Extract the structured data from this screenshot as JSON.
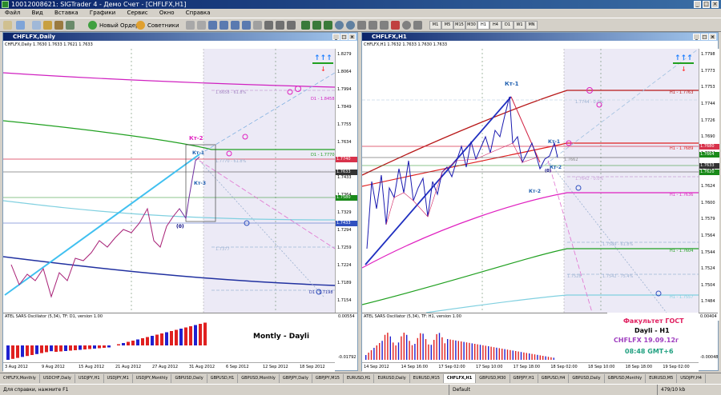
{
  "app": {
    "title": "10012008621: SIGTrader 4 - Демо Счет - [CHFLFX,H1]",
    "controls": [
      "_",
      "□",
      "×"
    ]
  },
  "menu": [
    "Файл",
    "Вид",
    "Вставка",
    "Графики",
    "Сервис",
    "Окно",
    "Справка"
  ],
  "toolbar": {
    "new_order": "Новый Ордер",
    "advisors": "Советники",
    "timeframes": [
      "M1",
      "M5",
      "M15",
      "M30",
      "H1",
      "H4",
      "D1",
      "W1",
      "MN"
    ]
  },
  "left_window": {
    "title": "CHFLFX,Daily",
    "price_line": "CHFLFX,Daily  1.7630 1.7633 1.7621 1.7633",
    "labels": {
      "kt2": "Кт-2",
      "kt1": "Кт-1",
      "kt3": "Кт-3",
      "zero": "(0)",
      "top_pct": "1.6658 - 61.8%",
      "d1_top": "D1 - 1.8458",
      "d1_mid": "D1 - 1.7770",
      "mid_pct": "1.7770 - 61.8%",
      "lower_label": "1.7377",
      "d1_bottom": "D1 - 1.7198"
    },
    "price_scale": [
      "1.8279",
      "1.8064",
      "1.7994",
      "1.7849",
      "1.7755",
      "1.7634",
      "1.7524",
      "1.7433",
      "1.7364",
      "1.7329",
      "1.7294",
      "1.7259",
      "1.7224",
      "1.7189",
      "1.7154"
    ],
    "price_tags": [
      {
        "value": "1.7740",
        "color": "#d8324b"
      },
      {
        "value": "1.7633",
        "color": "#333333"
      },
      {
        "value": "1.7580",
        "color": "#1a8a1a"
      },
      {
        "value": "1.7433",
        "color": "#3050c0"
      }
    ],
    "oscillator": {
      "title": "ATEL SARS Oscillator (5,34), TF: D1, version 1.00",
      "scale_top": "0.00554",
      "scale_bottom": "-0.01792"
    },
    "note": "Montly - Dayli",
    "dates": [
      "3 Aug 2012",
      "9 Aug 2012",
      "15 Aug 2012",
      "21 Aug 2012",
      "27 Aug 2012",
      "31 Aug 2012",
      "6 Sep 2012",
      "12 Sep 2012",
      "18 Sep 2012"
    ]
  },
  "right_window": {
    "title": "CHFLFX,H1",
    "price_line": "CHFLFX,H1  1.7632 1.7633 1.7630 1.7633",
    "labels": {
      "kt1_top": "Кт-1",
      "kt1": "Кт-1",
      "kt2": "Кт-2",
      "kt2b": "Кт-2",
      "zero": "(0)",
      "h1_top": "H1 - 1.7763",
      "h1_1": "H1 - 1.7689",
      "h1_2": "H1 - 1.7636",
      "h1_3": "H1 - 1.7604",
      "h1_4": "H1 - 1.7557",
      "pct_top": "1.7744 - 0.0%",
      "pct_mid": "1.7662",
      "pct_2": "1.7642 - 0.0%",
      "pct_3": "1.7589 - 61.8%",
      "pct_4": "1.7542 - 75.4%",
      "pct_5": "1.7528"
    },
    "price_scale": [
      "1.7798",
      "1.7773",
      "1.7753",
      "1.7744",
      "1.7726",
      "1.7690",
      "1.7664",
      "1.7645",
      "1.7624",
      "1.7600",
      "1.7579",
      "1.7564",
      "1.7544",
      "1.7524",
      "1.7504",
      "1.7484"
    ],
    "price_tags": [
      {
        "value": "1.7680",
        "color": "#d8324b"
      },
      {
        "value": "1.7664",
        "color": "#1a8a1a"
      },
      {
        "value": "1.7633",
        "color": "#333333"
      },
      {
        "value": "1.7620",
        "color": "#1a8a1a"
      }
    ],
    "oscillator": {
      "title": "ATEL SARS Oscillator (5,34), TF: H1, version 1.00",
      "scale_top": "0.00404",
      "scale_bottom": "-0.00048"
    },
    "info": {
      "line1": "Факультет ГОСТ",
      "line2": "Dayli - H1",
      "line3": "CHFLFX  19.09.12г",
      "line4": "08:48 GMT+6"
    },
    "dates": [
      "14 Sep 2012",
      "14 Sep 16:00",
      "17 Sep 02:00",
      "17 Sep 10:00",
      "17 Sep 18:00",
      "18 Sep 02:00",
      "18 Sep 10:00",
      "18 Sep 18:00",
      "19 Sep 02:00"
    ]
  },
  "tabs": [
    "CHFLFX,Monthly",
    "USDCHF,Daily",
    "USDJPY,H1",
    "USDJPY,M1",
    "USDJPY,Monthly",
    "GBPUSD,Daily",
    "GBPUSD,H1",
    "GBPUSD,Monthly",
    "GBPJPY,Daily",
    "GBPJPY,M15",
    "EURUSD,H1",
    "EURUSD,Daily",
    "EURUSD,M15",
    "CHFLFX,H1",
    "GBPUSD,M30",
    "GBPJPY,H1",
    "GBPUSD,H4",
    "GBPUSD,Daily",
    "GBPUSD,Monthly",
    "EURUSD,M5",
    "USDJPY,H4"
  ],
  "active_tab": "CHFLFX,H1",
  "status": {
    "help": "Для справки, нажмите F1",
    "profile": "Default",
    "traffic": "479/10 kb"
  }
}
